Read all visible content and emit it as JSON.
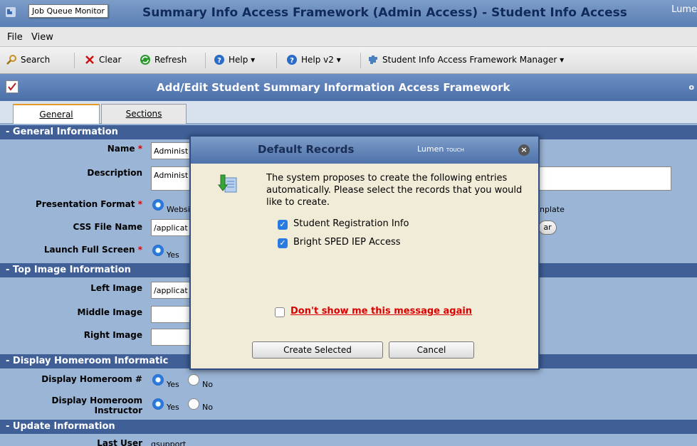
{
  "window": {
    "title": "Summary Info Access Framework (Admin Access) - Student Info Access",
    "tooltip": "Job Queue Monitor",
    "logo_text": "Lume"
  },
  "menu": {
    "file": "File",
    "view": "View"
  },
  "toolbar": {
    "search": "Search",
    "clear": "Clear",
    "refresh": "Refresh",
    "help": "Help ▾",
    "help_v2": "Help v2 ▾",
    "manager": "Student Info Access Framework Manager ▾"
  },
  "page": {
    "title": "Add/Edit Student Summary Information Access Framework",
    "right_char": "o"
  },
  "tabs": [
    {
      "label": "General"
    },
    {
      "label": "Sections"
    }
  ],
  "sections": {
    "general": "- General Information",
    "top_image": "- Top Image Information",
    "homeroom": "- Display Homeroom Informatic",
    "update": "- Update Information"
  },
  "fields": {
    "name_label": "Name",
    "name_value": "Administ",
    "description_label": "Description",
    "description_value": "Administ",
    "presentation_label": "Presentation Format",
    "presentation_option": "Websi",
    "presentation_right": "nplate",
    "css_label": "CSS File Name",
    "css_value": "/applicat",
    "css_btn": "ar",
    "launch_label": "Launch Full Screen",
    "launch_yes": "Yes",
    "left_image_label": "Left Image",
    "left_image_value": "/applicat",
    "middle_image_label": "Middle Image",
    "right_image_label": "Right Image",
    "homeroom_num_label": "Display Homeroom #",
    "homeroom_num_yes": "Yes",
    "homeroom_num_no": "No",
    "homeroom_instr_label1": "Display Homeroom",
    "homeroom_instr_label2": "Instructor",
    "homeroom_instr_yes": "Yes",
    "homeroom_instr_no": "No",
    "last_user_label": "Last User",
    "last_user_value": "gsupport",
    "required_mark": "*"
  },
  "dialog": {
    "title": "Default Records",
    "logo": "Lumen",
    "logo_sub": "TOUCH",
    "close": "×",
    "message": "The system proposes to create the following entries automatically. Please select the records that you would like to create.",
    "records": [
      {
        "label": "Student Registration Info",
        "checked": true
      },
      {
        "label": "Bright SPED IEP Access",
        "checked": true
      }
    ],
    "dont_show": "Don't show me this message again",
    "create_btn": "Create Selected",
    "cancel_btn": "Cancel"
  },
  "colors": {
    "header_blue": "#4a6fa8",
    "section_blue": "#3f5f96",
    "body_blue": "#9bb5d6",
    "dialog_bg": "#f0ecd8",
    "warning_red": "#dd0000"
  }
}
